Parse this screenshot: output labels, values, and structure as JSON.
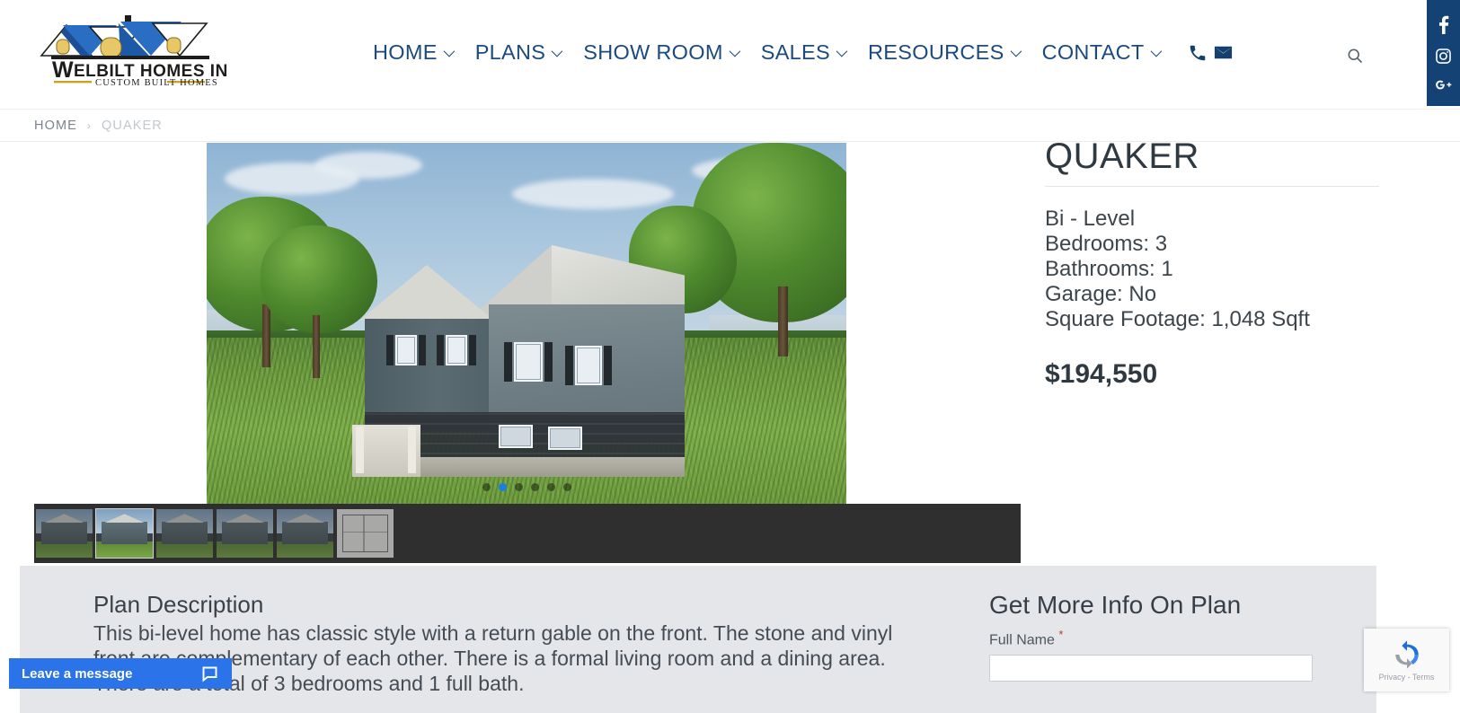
{
  "site": {
    "logo_name": "WELBILT HOMES INC.",
    "logo_tagline": "CUSTOM BUILT HOMES"
  },
  "nav": {
    "items": [
      {
        "label": "HOME",
        "has_dropdown": true
      },
      {
        "label": "PLANS",
        "has_dropdown": true
      },
      {
        "label": "SHOW ROOM",
        "has_dropdown": true
      },
      {
        "label": "SALES",
        "has_dropdown": true
      },
      {
        "label": "RESOURCES",
        "has_dropdown": true
      },
      {
        "label": "CONTACT",
        "has_dropdown": true
      }
    ],
    "phone_icon": "phone-icon",
    "email_icon": "envelope-icon",
    "search_icon": "search-icon"
  },
  "social": {
    "facebook": "facebook-icon",
    "instagram": "instagram-icon",
    "googleplus": "google-plus-icon",
    "bg_color": "#154274"
  },
  "breadcrumb": {
    "home": "HOME",
    "separator": "›",
    "current": "QUAKER"
  },
  "gallery": {
    "total_slides": 6,
    "active_slide": 2,
    "thumbnails": [
      {
        "type": "render",
        "label": "Front elevation"
      },
      {
        "type": "render",
        "label": "Front angle view"
      },
      {
        "type": "render",
        "label": "Side view"
      },
      {
        "type": "render",
        "label": "Rear angle view"
      },
      {
        "type": "render",
        "label": "Side angle view"
      },
      {
        "type": "floorplan",
        "label": "Floor plan"
      }
    ]
  },
  "details": {
    "title": "QUAKER",
    "style": "Bi - Level",
    "bedrooms": "Bedrooms: 3",
    "bathrooms": "Bathrooms: 1",
    "garage": "Garage: No",
    "square_footage": "Square Footage: 1,048 Sqft",
    "price": "$194,550"
  },
  "description": {
    "heading": "Plan Description",
    "body": "This bi-level home has classic style with a return gable on the front. The stone and vinyl front are complementary of each other. There is a formal living room and a dining area. There are a total of 3 bedrooms and 1 full bath."
  },
  "form": {
    "heading": "Get More Info On Plan",
    "full_name_label": "Full Name",
    "required_marker": "*",
    "full_name_value": "",
    "full_name_placeholder": ""
  },
  "chat": {
    "label": "Leave a message",
    "icon": "chat-bubble-icon",
    "bg_color": "#2b73e8"
  },
  "recaptcha": {
    "privacy_terms": "Privacy - Terms"
  }
}
